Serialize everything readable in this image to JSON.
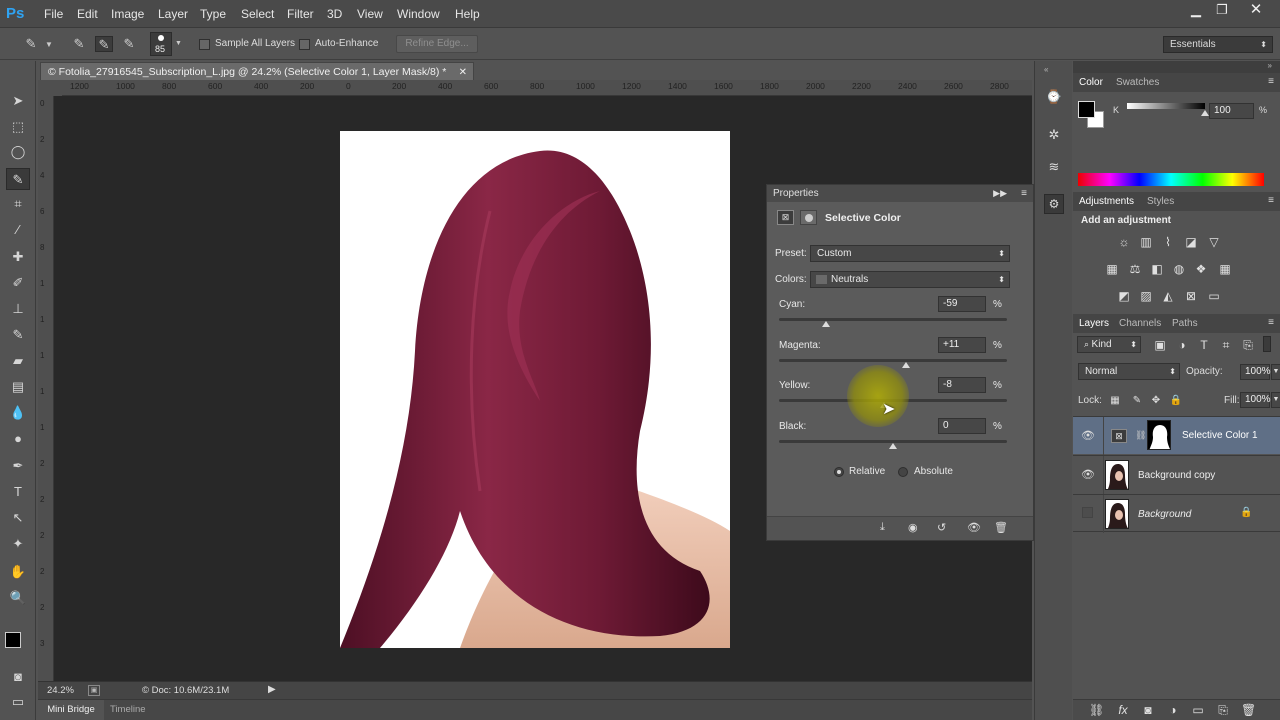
{
  "app": {
    "logo": "Ps"
  },
  "menu": [
    "File",
    "Edit",
    "Image",
    "Layer",
    "Type",
    "Select",
    "Filter",
    "3D",
    "View",
    "Window",
    "Help"
  ],
  "options": {
    "brush_size": "85",
    "sample_all_layers": "Sample All Layers",
    "auto_enhance": "Auto-Enhance",
    "refine_edge": "Refine Edge...",
    "workspace": "Essentials"
  },
  "document": {
    "tab_title": "© Fotolia_27916545_Subscription_L.jpg @ 24.2% (Selective Color 1, Layer Mask/8) *",
    "ruler_h": [
      "1200",
      "1000",
      "800",
      "600",
      "400",
      "200",
      "0",
      "200",
      "400",
      "600",
      "800",
      "1000",
      "1200",
      "1400",
      "1600",
      "1800",
      "2000",
      "2200",
      "2400",
      "2600",
      "2800"
    ],
    "ruler_v": [
      "0",
      "2",
      "4",
      "6",
      "8",
      "1",
      "1",
      "1",
      "1",
      "1",
      "2",
      "2",
      "2",
      "2",
      "2",
      "3"
    ],
    "zoom": "24.2%",
    "doc_size": "© Doc: 10.6M/23.1M"
  },
  "bottom_tabs": [
    "Mini Bridge",
    "Timeline"
  ],
  "properties": {
    "panel_title": "Properties",
    "title": "Selective Color",
    "preset_label": "Preset:",
    "preset_value": "Custom",
    "colors_label": "Colors:",
    "colors_value": "Neutrals",
    "sliders": [
      {
        "label": "Cyan:",
        "value": "-59",
        "pct": "%",
        "level": -59
      },
      {
        "label": "Magenta:",
        "value": "+11",
        "pct": "%",
        "level": 11
      },
      {
        "label": "Yellow:",
        "value": "-8",
        "pct": "%",
        "level": -8
      },
      {
        "label": "Black:",
        "value": "0",
        "pct": "%",
        "level": 0
      }
    ],
    "relative": "Relative",
    "absolute": "Absolute",
    "method_selected": "Relative"
  },
  "color_panel": {
    "tabs": [
      "Color",
      "Swatches"
    ],
    "k_label": "K",
    "k_value": "100",
    "pct": "%"
  },
  "adjustments": {
    "tabs": [
      "Adjustments",
      "Styles"
    ],
    "heading": "Add an adjustment"
  },
  "layers_panel": {
    "tabs": [
      "Layers",
      "Channels",
      "Paths"
    ],
    "kind": "Kind",
    "blend_mode": "Normal",
    "opacity_label": "Opacity:",
    "opacity": "100%",
    "lock_label": "Lock:",
    "fill_label": "Fill:",
    "fill": "100%",
    "layers": [
      {
        "name": "Selective Color 1",
        "selected": true,
        "visible": true
      },
      {
        "name": "Background copy",
        "selected": false,
        "visible": true
      },
      {
        "name": "Background",
        "selected": false,
        "visible": false,
        "locked": true
      }
    ]
  },
  "colors": {
    "accent": "#2fa3f2",
    "hair": "#7a1d38",
    "selected_layer": "#5f6f86"
  }
}
